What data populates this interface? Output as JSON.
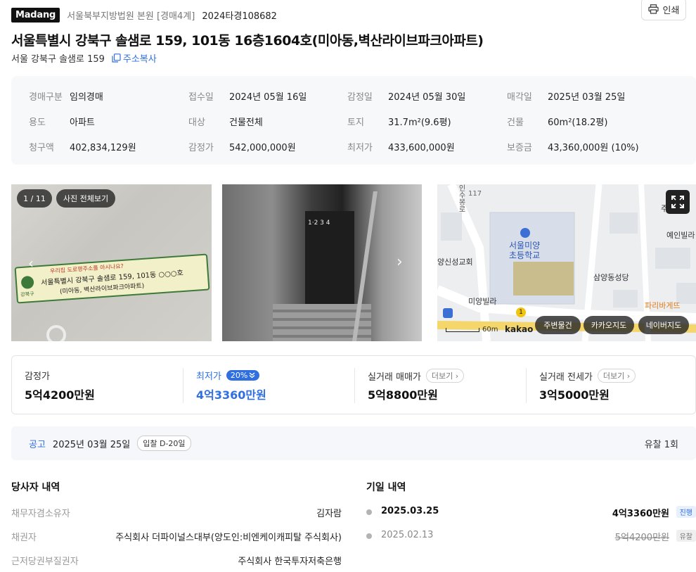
{
  "header": {
    "logo": "Madang",
    "court": "서울북부지방법원 본원 [경매4계]",
    "case_no": "2024타경108682",
    "print_label": "인쇄"
  },
  "property": {
    "title": "서울특별시 강북구 솔샘로 159, 101동 16층1604호(미아동,벽산라이브파크아파트)",
    "road_address": "서울 강북구 솔샘로 159",
    "copy_label": "주소복사"
  },
  "info": [
    {
      "label": "경매구분",
      "value": "임의경매"
    },
    {
      "label": "접수일",
      "value": "2024년 05월 16일"
    },
    {
      "label": "감정일",
      "value": "2024년 05월 30일"
    },
    {
      "label": "매각일",
      "value": "2025년 03월 25일"
    },
    {
      "label": "용도",
      "value": "아파트"
    },
    {
      "label": "대상",
      "value": "건물전체"
    },
    {
      "label": "토지",
      "value": "31.7m²(9.6평)"
    },
    {
      "label": "건물",
      "value": "60m²(18.2평)"
    },
    {
      "label": "청구액",
      "value": "402,834,129원"
    },
    {
      "label": "감정가",
      "value": "542,000,000원"
    },
    {
      "label": "최저가",
      "value": "433,600,000원"
    },
    {
      "label": "보증금",
      "value": "43,360,000원 (10%)"
    }
  ],
  "gallery": {
    "counter": "1 / 11",
    "view_all": "사진 전체보기",
    "sign_line1": "우리집 도로명주소를 아시나요?",
    "sign_line2": "서울특별시 강북구 솔샘로 159, 101동 ○○○호",
    "sign_line3": "(미아동, 벽산라이브파크아파트)",
    "sign_org": "강북구",
    "building_sign": "1·2 3 4"
  },
  "map": {
    "labels": {
      "school": "서울미양\n초등학교",
      "church1": "양신성교회",
      "church2": "삼양동성당",
      "villa1": "미양빌라",
      "villa2": "예인빌라",
      "bakery": "파리바게뜨",
      "road": "인수봉로",
      "num": "117",
      "scale": "60m",
      "brand": "kakao",
      "corner": "주"
    },
    "buttons": [
      "주변물건",
      "카카오지도",
      "네이버지도"
    ]
  },
  "prices": {
    "appraisal_label": "감정가",
    "appraisal_value": "5억4200만원",
    "min_label": "최저가",
    "min_badge": "20%",
    "min_value": "4억3360만원",
    "trade_label": "실거래 매매가",
    "trade_value": "5억8800만원",
    "jeonse_label": "실거래 전세가",
    "jeonse_value": "3억5000만원",
    "more_label": "더보기"
  },
  "notice": {
    "label": "공고",
    "date": "2025년 03월 25일",
    "dday": "입찰 D-20일",
    "fail_count": "유찰 1회"
  },
  "parties": {
    "title": "당사자 내역",
    "rows": [
      {
        "role": "채무자겸소유자",
        "name": "김자람"
      },
      {
        "role": "채권자",
        "name": "주식회사 더파이널스대부(양도인:비엔케이캐피탈 주식회사)"
      },
      {
        "role": "근저당권부질권자",
        "name": "주식회사 한국투자저축은행"
      }
    ]
  },
  "history": {
    "title": "기일 내역",
    "rows": [
      {
        "date": "2025.03.25",
        "price": "4억3360만원",
        "status": "진행"
      },
      {
        "date": "2025.02.13",
        "price": "5억4200만원",
        "status": "유찰"
      }
    ]
  },
  "colors": {
    "accent": "#2f6fe0",
    "logo_bg": "#111111",
    "info_bg": "#f7f8fa"
  }
}
